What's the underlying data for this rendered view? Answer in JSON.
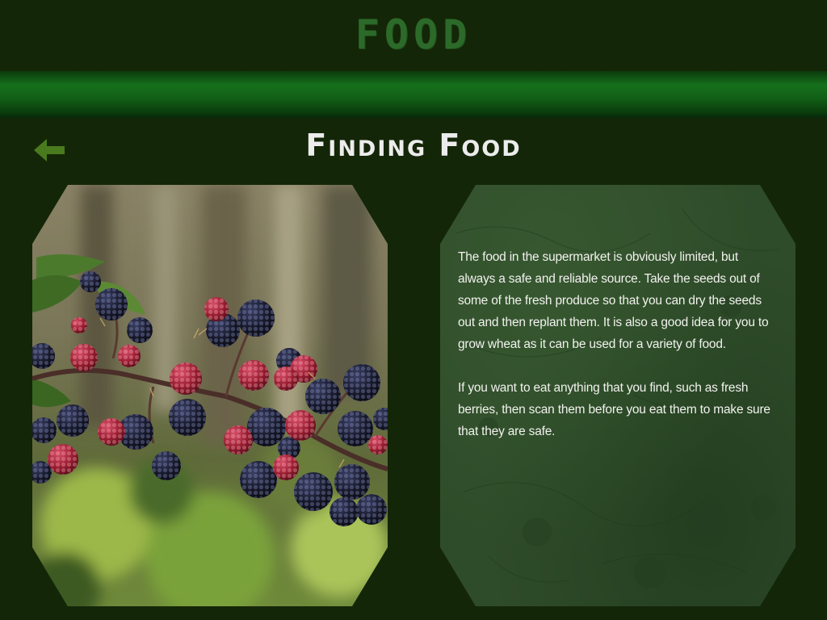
{
  "app": {
    "title": "FOOD"
  },
  "nav": {
    "back_icon": "left-arrow-icon"
  },
  "page": {
    "title": "Finding Food"
  },
  "photo": {
    "subject": "blackberries-photo"
  },
  "content": {
    "paragraphs": [
      "The food in the supermarket is obviously limited, but always a safe and reliable source. Take the seeds out of some of the fresh produce so that you can dry the seeds out and then replant them.  It is also a good idea for you to grow wheat as it can be used for a variety of  food.",
      "If you want to eat anything that you find, such as fresh berries, then scan them before you eat them to make sure that they are safe."
    ]
  },
  "colors": {
    "background": "#142608",
    "stripe": "#15701c",
    "title_green": "#2c6a2a",
    "arrow_green": "#4a7a1e",
    "panel": "#2f4c2a"
  }
}
